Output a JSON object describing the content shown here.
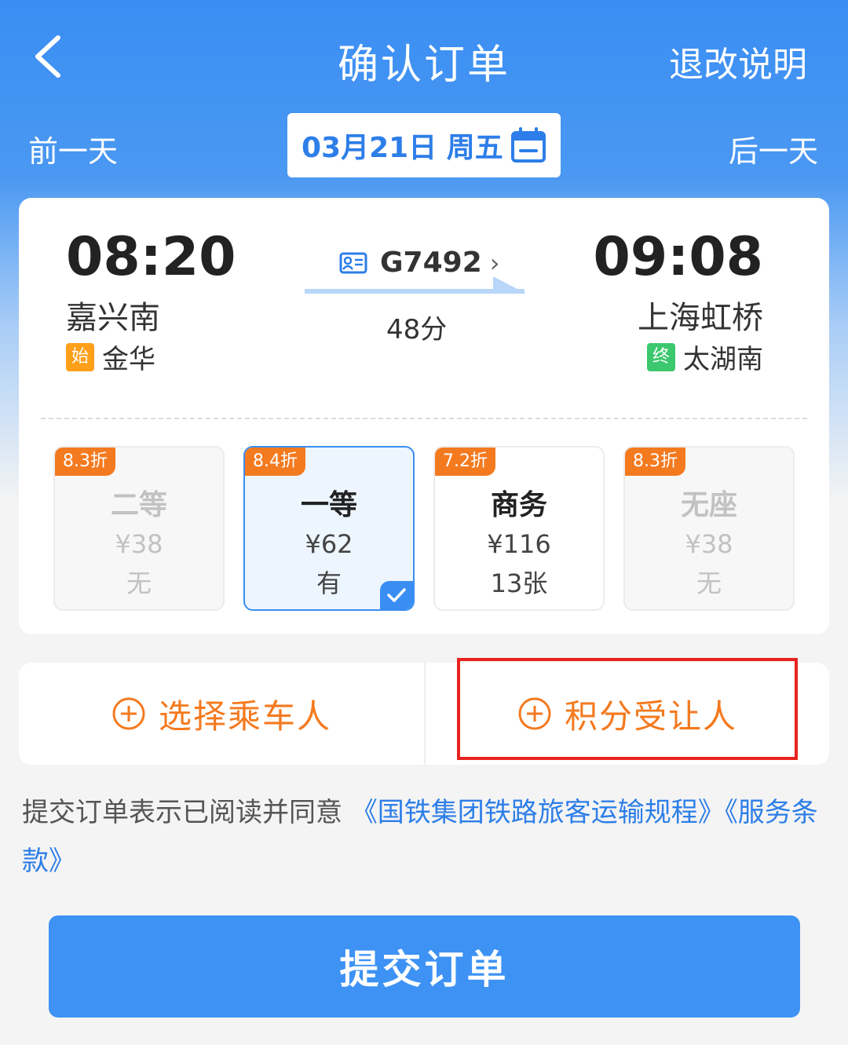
{
  "header": {
    "title": "确认订单",
    "refund_link": "退改说明"
  },
  "datebar": {
    "prev_label": "前一天",
    "next_label": "后一天",
    "date": "03月21日 周五"
  },
  "trip": {
    "departure_time": "08:20",
    "arrival_time": "09:08",
    "departure_station": "嘉兴南",
    "arrival_station": "上海虹桥",
    "origin_tag": "始",
    "origin_station": "金华",
    "terminal_tag": "终",
    "terminal_station": "太湖南",
    "train_number": "G7492",
    "duration": "48分"
  },
  "seats": [
    {
      "discount": "8.3折",
      "name": "二等",
      "price": "¥38",
      "stock": "无",
      "state": "unavailable"
    },
    {
      "discount": "8.4折",
      "name": "一等",
      "price": "¥62",
      "stock": "有",
      "state": "selected"
    },
    {
      "discount": "7.2折",
      "name": "商务",
      "price": "¥116",
      "stock": "13张",
      "state": "available"
    },
    {
      "discount": "8.3折",
      "name": "无座",
      "price": "¥38",
      "stock": "无",
      "state": "unavailable"
    }
  ],
  "passengers": {
    "select_label": "选择乘车人",
    "points_label": "积分受让人"
  },
  "agreement": {
    "prefix": "提交订单表示已阅读并同意",
    "link1": "《国铁集团铁路旅客运输规程》",
    "link2": "《服务条款》"
  },
  "submit_label": "提交订单",
  "colors": {
    "primary_blue": "#3a8ef3",
    "orange": "#f47a1f",
    "highlight_red": "#e8231e",
    "green_tag": "#3cc86e"
  },
  "icons": [
    "back-arrow-icon",
    "calendar-icon",
    "train-id-card-icon",
    "chevron-right-icon",
    "direction-arrow-icon",
    "checkmark-icon",
    "add-circle-icon"
  ]
}
